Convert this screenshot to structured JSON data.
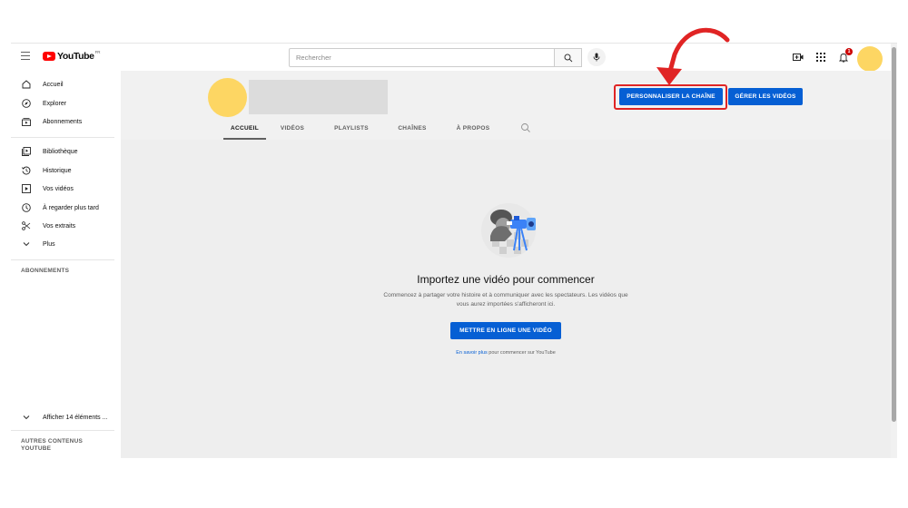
{
  "topbar": {
    "logo_text": "YouTube",
    "logo_country": "FR",
    "search_placeholder": "Rechercher"
  },
  "sidebar": {
    "items": [
      {
        "label": "Accueil",
        "icon": "home-icon"
      },
      {
        "label": "Explorer",
        "icon": "compass-icon"
      },
      {
        "label": "Abonnements",
        "icon": "subscriptions-icon"
      },
      {
        "label": "Bibliothèque",
        "icon": "library-icon"
      },
      {
        "label": "Historique",
        "icon": "history-icon"
      },
      {
        "label": "Vos vidéos",
        "icon": "your-videos-icon"
      },
      {
        "label": "À regarder plus tard",
        "icon": "clock-icon"
      },
      {
        "label": "Vos extraits",
        "icon": "scissors-icon"
      },
      {
        "label": "Plus",
        "icon": "chevron-down-icon"
      }
    ],
    "subscriptions_heading": "ABONNEMENTS",
    "show_more": "Afficher 14 éléments ...",
    "more_from_heading": "AUTRES CONTENUS YOUTUBE"
  },
  "channel": {
    "customize_button": "PERSONNALISER LA CHAÎNE",
    "manage_button": "GÉRER LES VIDÉOS",
    "tabs": [
      "ACCUEIL",
      "VIDÉOS",
      "PLAYLISTS",
      "CHAÎNES",
      "À PROPOS"
    ],
    "active_tab": "ACCUEIL"
  },
  "empty_state": {
    "title": "Importez une vidéo pour commencer",
    "description": "Commencez à partager votre histoire et à communiquer avec les spectateurs. Les vidéos que vous aurez importées s'afficheront ici.",
    "upload_button": "METTRE EN LIGNE UNE VIDÉO",
    "learn_more_link": "En savoir plus",
    "learn_more_rest": " pour commencer sur YouTube"
  },
  "notifications": {
    "badge": "1"
  },
  "colors": {
    "brand_red": "#ff0000",
    "primary_blue": "#065fd4",
    "avatar_yellow": "#fdd663",
    "annotation_red": "#e02424"
  }
}
